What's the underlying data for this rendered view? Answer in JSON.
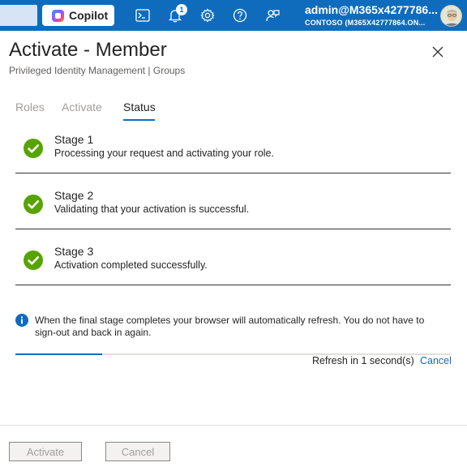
{
  "topbar": {
    "copilot_label": "Copilot",
    "notification_count": "1",
    "account_name": "admin@M365x4277786...",
    "account_tenant": "CONTOSO (M365X42777864.ON...",
    "icons": [
      "cloud-shell-icon",
      "bell-icon",
      "settings-icon",
      "help-icon",
      "feedback-icon"
    ]
  },
  "header": {
    "title": "Activate - Member",
    "subtitle": "Privileged Identity Management | Groups"
  },
  "tabs": [
    {
      "label": "Roles",
      "active": false
    },
    {
      "label": "Activate",
      "active": false
    },
    {
      "label": "Status",
      "active": true
    }
  ],
  "stages": [
    {
      "title": "Stage 1",
      "description": "Processing your request and activating your role."
    },
    {
      "title": "Stage 2",
      "description": "Validating that your activation is successful."
    },
    {
      "title": "Stage 3",
      "description": "Activation completed successfully."
    }
  ],
  "info": {
    "text": "When the final stage completes your browser will automatically refresh. You do not have to sign-out and back in again."
  },
  "refresh": {
    "text": "Refresh in 1 second(s)",
    "cancel_label": "Cancel",
    "progress": 0.2
  },
  "footer": {
    "activate_label": "Activate",
    "cancel_label": "Cancel"
  },
  "colors": {
    "accent": "#0f6cbd",
    "success": "#57a300"
  }
}
